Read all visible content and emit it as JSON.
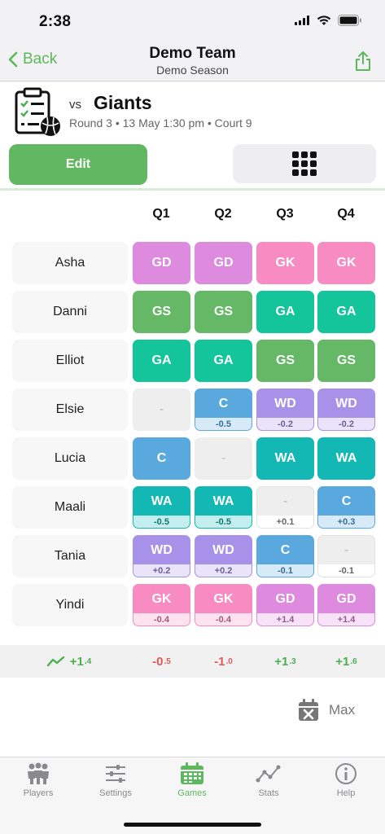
{
  "status": {
    "time": "2:38"
  },
  "nav": {
    "back_label": "Back",
    "title": "Demo Team",
    "subtitle": "Demo Season"
  },
  "game": {
    "vs": "vs",
    "opponent": "Giants",
    "meta": "Round 3 • 13 May 1:30 pm • Court 9"
  },
  "actions": {
    "edit_label": "Edit"
  },
  "quarters": [
    "Q1",
    "Q2",
    "Q3",
    "Q4"
  ],
  "colors": {
    "GD": "#de8ade",
    "GK": "#f98bc3",
    "GS": "#65b865",
    "GA": "#14c49a",
    "C": "#5aa9de",
    "WD": "#a891e8",
    "WA": "#13b8b5",
    "bench": "#eeeeee"
  },
  "players": [
    {
      "name": "Asha",
      "cells": [
        {
          "pos": "GD"
        },
        {
          "pos": "GD"
        },
        {
          "pos": "GK"
        },
        {
          "pos": "GK"
        }
      ]
    },
    {
      "name": "Danni",
      "cells": [
        {
          "pos": "GS"
        },
        {
          "pos": "GS"
        },
        {
          "pos": "GA"
        },
        {
          "pos": "GA"
        }
      ]
    },
    {
      "name": "Elliot",
      "cells": [
        {
          "pos": "GA"
        },
        {
          "pos": "GA"
        },
        {
          "pos": "GS"
        },
        {
          "pos": "GS"
        }
      ]
    },
    {
      "name": "Elsie",
      "cells": [
        {
          "pos": "-"
        },
        {
          "pos": "C",
          "delta": "-0.5"
        },
        {
          "pos": "WD",
          "delta": "-0.2"
        },
        {
          "pos": "WD",
          "delta": "-0.2"
        }
      ]
    },
    {
      "name": "Lucia",
      "cells": [
        {
          "pos": "C"
        },
        {
          "pos": "-"
        },
        {
          "pos": "WA"
        },
        {
          "pos": "WA"
        }
      ]
    },
    {
      "name": "Maali",
      "cells": [
        {
          "pos": "WA",
          "delta": "-0.5"
        },
        {
          "pos": "WA",
          "delta": "-0.5"
        },
        {
          "pos": "-",
          "delta": "+0.1"
        },
        {
          "pos": "C",
          "delta": "+0.3"
        }
      ]
    },
    {
      "name": "Tania",
      "cells": [
        {
          "pos": "WD",
          "delta": "+0.2"
        },
        {
          "pos": "WD",
          "delta": "+0.2"
        },
        {
          "pos": "C",
          "delta": "-0.1"
        },
        {
          "pos": "-",
          "delta": "-0.1"
        }
      ]
    },
    {
      "name": "Yindi",
      "cells": [
        {
          "pos": "GK",
          "delta": "-0.4"
        },
        {
          "pos": "GK",
          "delta": "-0.4"
        },
        {
          "pos": "GD",
          "delta": "+1.4"
        },
        {
          "pos": "GD",
          "delta": "+1.4"
        }
      ]
    }
  ],
  "totals": [
    {
      "main": "+1",
      "sup": ".4",
      "tone": "green",
      "icon": "trend-up-icon"
    },
    {
      "main": "-0",
      "sup": ".5",
      "tone": "red"
    },
    {
      "main": "-1",
      "sup": ".0",
      "tone": "red"
    },
    {
      "main": "+1",
      "sup": ".3",
      "tone": "green"
    },
    {
      "main": "+1",
      "sup": ".6",
      "tone": "green"
    }
  ],
  "max": {
    "label": "Max",
    "icon": "calendar-x-icon"
  },
  "tabs": [
    {
      "label": "Players",
      "icon": "players-icon",
      "active": false
    },
    {
      "label": "Settings",
      "icon": "sliders-icon",
      "active": false
    },
    {
      "label": "Games",
      "icon": "calendar-icon",
      "active": true
    },
    {
      "label": "Stats",
      "icon": "stats-icon",
      "active": false
    },
    {
      "label": "Help",
      "icon": "info-icon",
      "active": false
    }
  ]
}
